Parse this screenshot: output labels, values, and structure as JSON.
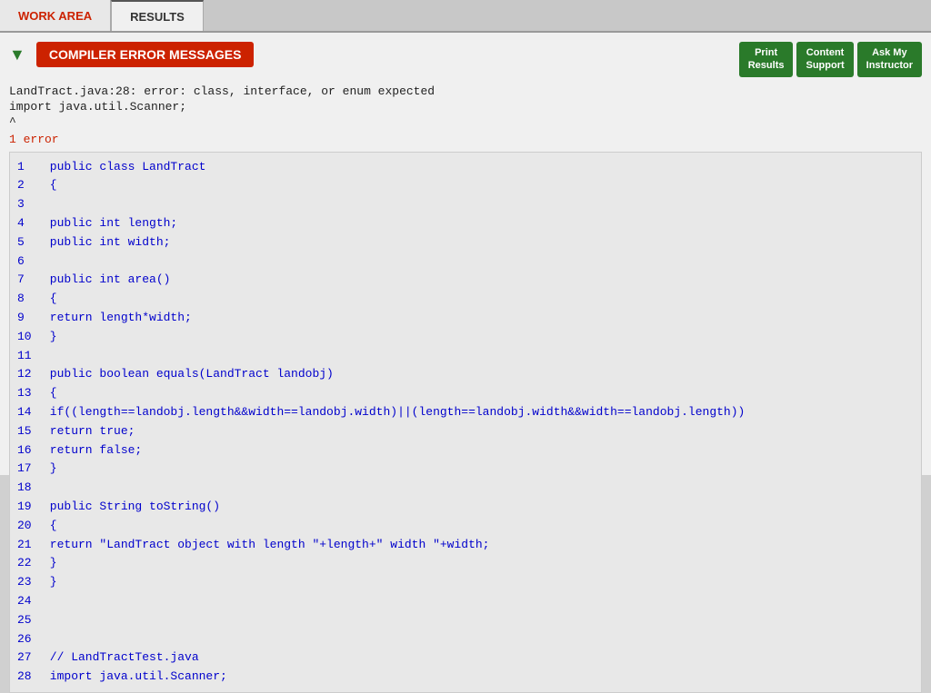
{
  "tabs": [
    {
      "label": "WORK AREA",
      "active": false
    },
    {
      "label": "RESULTS",
      "active": true
    }
  ],
  "toolbar": {
    "triangle": "▼",
    "banner": "COMPILER ERROR MESSAGES",
    "buttons": [
      {
        "label": "Print\nResults"
      },
      {
        "label": "Content\nSupport"
      },
      {
        "label": "Ask My\nInstructor"
      }
    ]
  },
  "error_messages": {
    "line1": "LandTract.java:28: error: class, interface, or enum expected",
    "line2": "import java.util.Scanner;",
    "line3": "^",
    "count": "1 error"
  },
  "code_lines": [
    {
      "num": "1",
      "content": " public class LandTract"
    },
    {
      "num": "2",
      "content": " {"
    },
    {
      "num": "3",
      "content": ""
    },
    {
      "num": "4",
      "content": " public int length;"
    },
    {
      "num": "5",
      "content": " public int width;"
    },
    {
      "num": "6",
      "content": ""
    },
    {
      "num": "7",
      "content": " public int area()"
    },
    {
      "num": "8",
      "content": " {"
    },
    {
      "num": "9",
      "content": " return length*width;"
    },
    {
      "num": "10",
      "content": " }"
    },
    {
      "num": "11",
      "content": ""
    },
    {
      "num": "12",
      "content": " public boolean equals(LandTract landobj)"
    },
    {
      "num": "13",
      "content": " {"
    },
    {
      "num": "14",
      "content": " if((length==landobj.length&&width==landobj.width)||(length==landobj.width&&width==landobj.length))"
    },
    {
      "num": "15",
      "content": " return true;"
    },
    {
      "num": "16",
      "content": " return false;"
    },
    {
      "num": "17",
      "content": " }"
    },
    {
      "num": "18",
      "content": ""
    },
    {
      "num": "19",
      "content": " public String toString()"
    },
    {
      "num": "20",
      "content": " {"
    },
    {
      "num": "21",
      "content": " return \"LandTract object with length \"+length+\" width \"+width;"
    },
    {
      "num": "22",
      "content": " }"
    },
    {
      "num": "23",
      "content": " }"
    },
    {
      "num": "24",
      "content": ""
    },
    {
      "num": "25",
      "content": ""
    },
    {
      "num": "26",
      "content": ""
    },
    {
      "num": "27",
      "content": " // LandTractTest.java"
    },
    {
      "num": "28",
      "content": " import java.util.Scanner;"
    }
  ]
}
